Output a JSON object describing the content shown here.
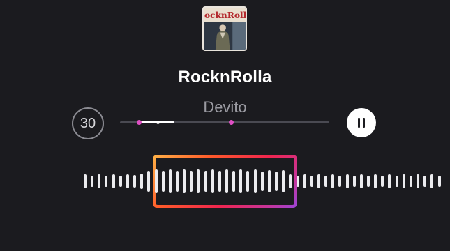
{
  "song": {
    "title": "RocknRolla",
    "artist": "Devito",
    "album_art_text": "RocknRolla"
  },
  "clip": {
    "duration_label": "30",
    "selection_start_fraction": 0.09,
    "selection_end_fraction": 0.26,
    "marker_fractions": [
      0.09,
      0.53
    ]
  },
  "controls": {
    "play_state": "paused-icon",
    "pause_icon": "pause-icon"
  },
  "waveform": {
    "bar_heights": [
      20,
      16,
      20,
      16,
      20,
      16,
      20,
      18,
      22,
      30,
      34,
      30,
      34,
      30,
      34,
      30,
      34,
      30,
      34,
      30,
      34,
      30,
      34,
      30,
      34,
      28,
      32,
      28,
      32,
      20,
      16,
      20,
      16,
      20,
      16,
      20,
      16,
      20,
      16,
      20,
      16,
      20,
      16,
      20,
      16,
      20,
      16,
      20,
      16,
      20,
      16
    ]
  },
  "colors": {
    "background": "#1b1b1f",
    "accent_marker": "#e04fc4",
    "gradient_start": "#ffb347",
    "gradient_end": "#9b45d8"
  }
}
